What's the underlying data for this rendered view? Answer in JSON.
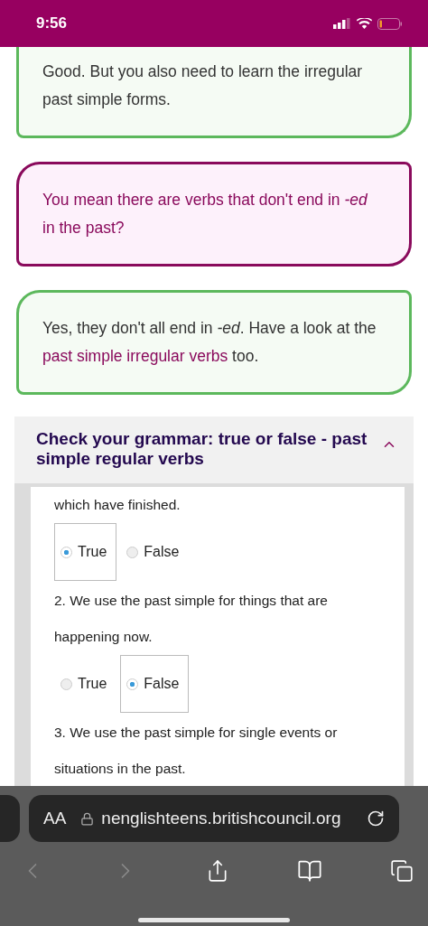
{
  "status_bar": {
    "time": "9:56",
    "battery_low": true
  },
  "messages": [
    {
      "kind": "teacher",
      "text": "Good. But you also need to learn the irregular past simple forms."
    },
    {
      "kind": "student",
      "text": "You mean there are verbs that don't end in *-ed* in the past?"
    },
    {
      "kind": "teacher",
      "text": "Yes, they don't all end in *-ed*. Have a look at the",
      "link": "past simple irregular verbs",
      "text_after": "too."
    }
  ],
  "quiz": {
    "title": "Check your grammar: true or false - past simple regular verbs",
    "expanded": true,
    "questions": [
      {
        "text": "which have finished.",
        "options": [
          {
            "label": "True",
            "selected": true
          },
          {
            "label": "False",
            "selected": false
          }
        ]
      },
      {
        "text": "2. We use the past simple for things that are happening now.",
        "options": [
          {
            "label": "True",
            "selected": false
          },
          {
            "label": "False",
            "selected": true
          }
        ]
      },
      {
        "text": "3. We use the past simple for single events or situations in the past."
      }
    ]
  },
  "browser": {
    "text_size": "AA",
    "url": "nenglishteens.britishcouncil.org"
  }
}
